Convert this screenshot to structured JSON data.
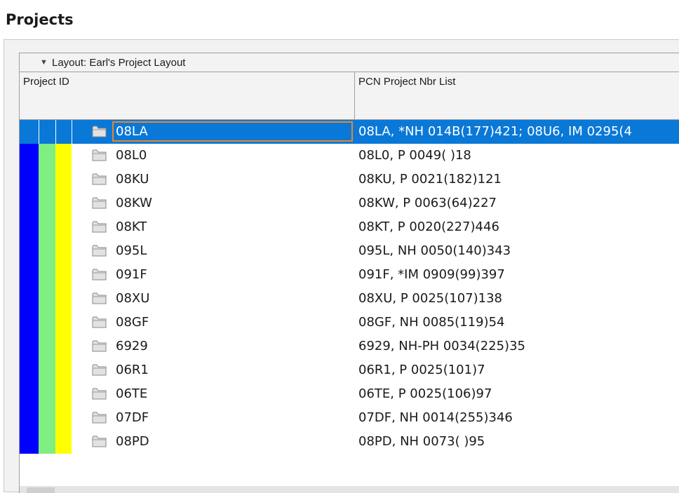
{
  "title": "Projects",
  "layout_label": "Layout: Earl's Project Layout",
  "columns": {
    "project_id": "Project ID",
    "pcn": "PCN Project Nbr List"
  },
  "colors": {
    "selection": "#0a78d7",
    "focus_border": "#e8872a",
    "stripe_1": "#0000ff",
    "stripe_2": "#80ee80",
    "stripe_3": "#ffff00"
  },
  "rows": [
    {
      "id": "08LA",
      "pcn": "08LA, *NH 014B(177)421; 08U6, IM 0295(4"
    },
    {
      "id": "08L0",
      "pcn": "08L0, P 0049(  )18"
    },
    {
      "id": "08KU",
      "pcn": "08KU, P 0021(182)121"
    },
    {
      "id": "08KW",
      "pcn": "08KW, P 0063(64)227"
    },
    {
      "id": "08KT",
      "pcn": "08KT, P 0020(227)446"
    },
    {
      "id": "095L",
      "pcn": "095L, NH 0050(140)343"
    },
    {
      "id": "091F",
      "pcn": "091F, *IM 0909(99)397"
    },
    {
      "id": "08XU",
      "pcn": "08XU, P 0025(107)138"
    },
    {
      "id": "08GF",
      "pcn": "08GF, NH 0085(119)54"
    },
    {
      "id": "6929",
      "pcn": "6929, NH-PH 0034(225)35"
    },
    {
      "id": "06R1",
      "pcn": "06R1, P 0025(101)7"
    },
    {
      "id": "06TE",
      "pcn": "06TE, P 0025(106)97"
    },
    {
      "id": "07DF",
      "pcn": "07DF, NH 0014(255)346"
    },
    {
      "id": "08PD",
      "pcn": "08PD, NH 0073(  )95"
    }
  ]
}
